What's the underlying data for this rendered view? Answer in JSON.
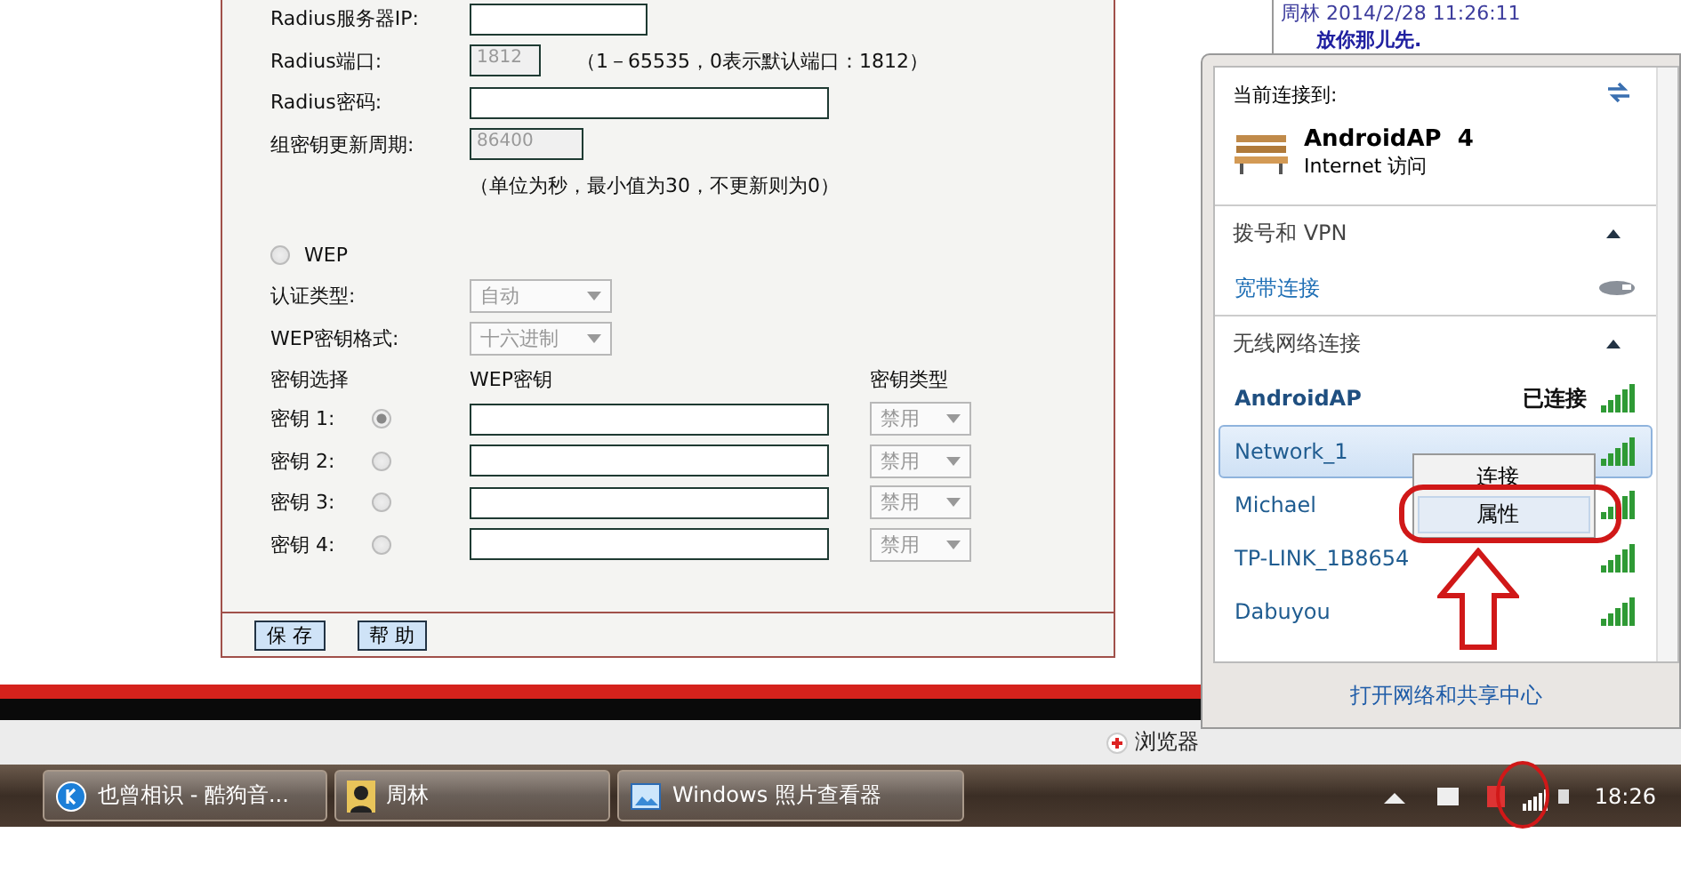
{
  "router_form": {
    "fields": [
      {
        "kind": "text",
        "label": "Radius服务器IP:",
        "disabled": false
      },
      {
        "kind": "text",
        "label": "Radius端口:",
        "value": "1812",
        "disabled": true,
        "hint": "（1－65535，0表示默认端口：1812）"
      },
      {
        "kind": "text",
        "label": "Radius密码:",
        "disabled": false
      },
      {
        "kind": "text",
        "label": "组密钥更新周期:",
        "value": "86400",
        "disabled": true
      }
    ],
    "period_note": "（单位为秒，最小值为30，不更新则为0）",
    "wep": {
      "label": "WEP",
      "selected": false
    },
    "selects": [
      {
        "label": "认证类型:",
        "value": "自动",
        "disabled": true
      },
      {
        "label": "WEP密钥格式:",
        "value": "十六进制",
        "disabled": true
      }
    ],
    "key_headers": [
      "密钥选择",
      "WEP密钥",
      "密钥类型"
    ],
    "keys": [
      {
        "label": "密钥 1:",
        "selected": true,
        "type": "禁用"
      },
      {
        "label": "密钥 2:",
        "selected": false,
        "type": "禁用"
      },
      {
        "label": "密钥 3:",
        "selected": false,
        "type": "禁用"
      },
      {
        "label": "密钥 4:",
        "selected": false,
        "type": "禁用"
      }
    ],
    "buttons": [
      "保 存",
      "帮 助"
    ]
  },
  "chat": {
    "header": "周林 2014/2/28 11:26:11",
    "message": "放你那儿先."
  },
  "status_strip": {
    "label": "浏览器"
  },
  "taskbar": {
    "items": [
      {
        "kind": "music",
        "label": "也曾相识 - 酷狗音..."
      },
      {
        "kind": "contact",
        "label": "周林"
      },
      {
        "kind": "photo",
        "label": "Windows 照片查看器"
      }
    ],
    "clock": "18:26"
  },
  "network_flyout": {
    "current_label": "当前连接到:",
    "current": {
      "name": "AndroidAP  4",
      "access": "Internet 访问"
    },
    "sections": [
      {
        "title": "拨号和 VPN",
        "expanded": true,
        "items": [
          {
            "kind": "dialup",
            "name": "宽带连接"
          }
        ]
      },
      {
        "title": "无线网络连接",
        "expanded": true,
        "items": [
          {
            "kind": "wifi",
            "name": "AndroidAP",
            "status": "已连接",
            "connected": true,
            "selected": false
          },
          {
            "kind": "wifi",
            "name": "Network_1",
            "connected": false,
            "selected": true
          },
          {
            "kind": "wifi",
            "name": "Michael",
            "connected": false,
            "selected": false
          },
          {
            "kind": "wifi",
            "name": "TP-LINK_1B8654",
            "connected": false,
            "selected": false
          },
          {
            "kind": "wifi",
            "name": "Dabuyou",
            "connected": false,
            "selected": false
          }
        ]
      }
    ],
    "footer_link": "打开网络和共享中心"
  },
  "context_menu": {
    "items": [
      {
        "label": "连接",
        "selected": false
      },
      {
        "label": "属性",
        "selected": true
      }
    ]
  }
}
